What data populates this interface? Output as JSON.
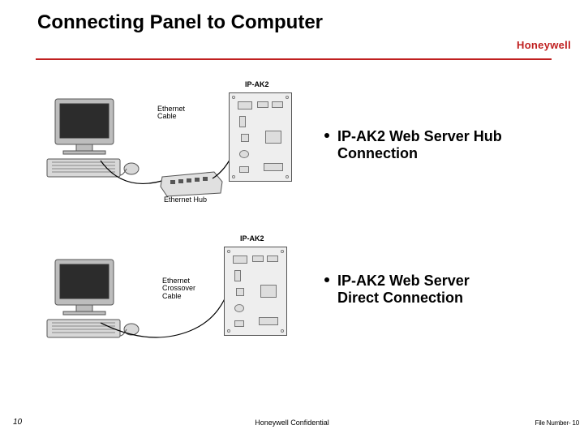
{
  "title": "Connecting Panel to Computer",
  "brand": "Honeywell",
  "diagrams": {
    "one": {
      "panel_label": "IP-AK2",
      "cable_label_l1": "Ethernet",
      "cable_label_l2": "Cable",
      "hub_label": "Ethernet Hub"
    },
    "two": {
      "panel_label": "IP-AK2",
      "cable_label_l1": "Ethernet",
      "cable_label_l2": "Crossover",
      "cable_label_l3": "Cable"
    }
  },
  "bullets": {
    "one_l1": "IP-AK2 Web Server Hub",
    "one_l2": "Connection",
    "two_l1": "IP-AK2 Web Server",
    "two_l2": "Direct Connection"
  },
  "footer": {
    "page_no": "10",
    "confidential": "Honeywell Confidential",
    "file_prefix": "File Number- ",
    "file_no": "10"
  }
}
